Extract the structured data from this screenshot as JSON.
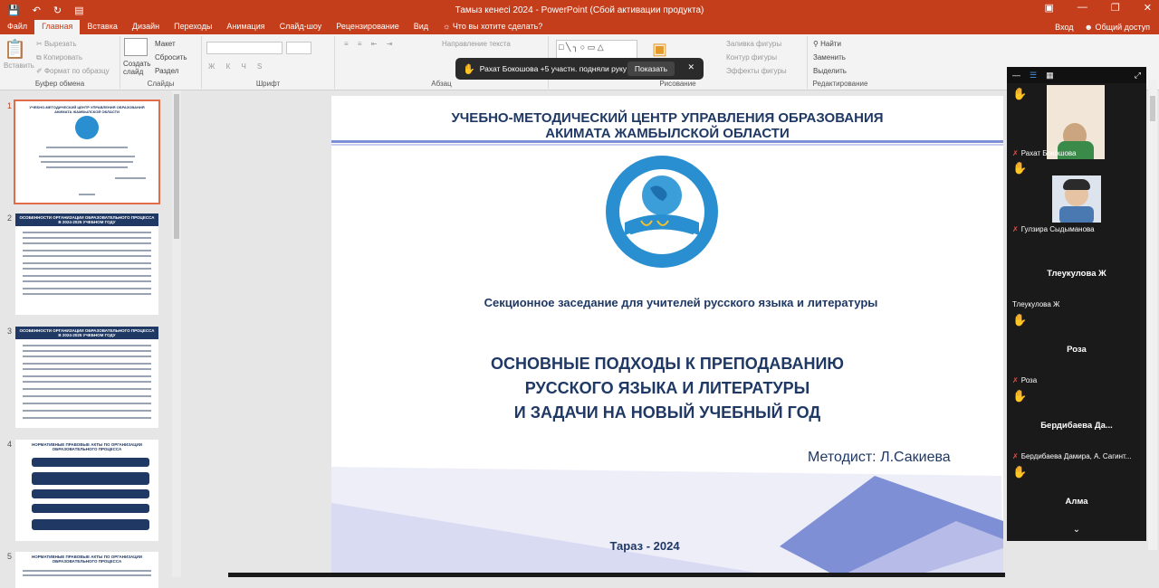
{
  "window": {
    "title": "Тамыз кенесі 2024 - PowerPoint (Сбой активации продукта)",
    "quick_access": [
      "save-icon",
      "undo-icon",
      "redo-icon",
      "present-icon"
    ]
  },
  "tabs": [
    "Файл",
    "Главная",
    "Вставка",
    "Дизайн",
    "Переходы",
    "Анимация",
    "Слайд-шоу",
    "Рецензирование",
    "Вид"
  ],
  "active_tab": "Главная",
  "tell_me": "Что вы хотите сделать?",
  "account": {
    "signin": "Вход",
    "share": "Общий доступ"
  },
  "ribbon": {
    "clipboard": {
      "label": "Буфер обмена",
      "paste": "Вставить",
      "cut": "Вырезать",
      "copy": "Копировать",
      "format": "Формат по образцу"
    },
    "slides": {
      "label": "Слайды",
      "new": "Создать слайд",
      "layout": "Макет",
      "reset": "Сбросить",
      "section": "Раздел"
    },
    "font": {
      "label": "Шрифт"
    },
    "paragraph": {
      "label": "Абзац",
      "direction": "Направление текста"
    },
    "drawing": {
      "label": "Рисование",
      "fill": "Заливка фигуры",
      "outline": "Контур фигуры",
      "effects": "Эффекты фигуры"
    },
    "editing": {
      "label": "Редактирование",
      "find": "Найти",
      "replace": "Заменить",
      "select": "Выделить"
    }
  },
  "toast": {
    "text": "Рахат Бокошова +5 участн. подняли руку",
    "button": "Показать"
  },
  "thumbnails": [
    {
      "num": "1",
      "title": "УЧЕБНО-МЕТОДИЧЕСКИЙ ЦЕНТР УПРАВЛЕНИЯ ОБРАЗОВАНИЯ АКИМАТА ЖАМБЫЛСКОЙ ОБЛАСТИ",
      "selected": true
    },
    {
      "num": "2",
      "title": "ОСОБЕННОСТИ ОРГАНИЗАЦИИ ОБРАЗОВАТЕЛЬНОГО ПРОЦЕССА В 2024-2025 УЧЕБНОМ ГОДУ",
      "selected": false
    },
    {
      "num": "3",
      "title": "ОСОБЕННОСТИ ОРГАНИЗАЦИИ ОБРАЗОВАТЕЛЬНОГО ПРОЦЕССА В 2024-2025 УЧЕБНОМ ГОДУ",
      "selected": false
    },
    {
      "num": "4",
      "title": "НОРМАТИВНЫЕ ПРАВОВЫЕ АКТЫ ПО ОРГАНИЗАЦИИ ОБРАЗОВАТЕЛЬНОГО ПРОЦЕССА",
      "selected": false
    },
    {
      "num": "5",
      "title": "НОРМАТИВНЫЕ ПРАВОВЫЕ АКТЫ ПО ОРГАНИЗАЦИИ ОБРАЗОВАТЕЛЬНОГО ПРОЦЕССА",
      "selected": false
    }
  ],
  "slide": {
    "header_line1": "УЧЕБНО-МЕТОДИЧЕСКИЙ ЦЕНТР УПРАВЛЕНИЯ ОБРАЗОВАНИЯ",
    "header_line2": "АКИМАТА ЖАМБЫЛСКОЙ ОБЛАСТИ",
    "subtitle": "Секционное заседание для учителей русского языка и литературы",
    "title_line1": "ОСНОВНЫЕ ПОДХОДЫ К ПРЕПОДАВАНИЮ",
    "title_line2": "РУССКОГО ЯЗЫКА И ЛИТЕРАТУРЫ",
    "title_line3": "И ЗАДАЧИ НА НОВЫЙ УЧЕБНЫЙ ГОД",
    "author": "Методист: Л.Сакиева",
    "footer": "Тараз - 2024",
    "colors": {
      "navy": "#1f3864",
      "accent": "#7f8fd6",
      "light": "#c9ccee"
    }
  },
  "gallery": {
    "participants": [
      {
        "name": "Рахат Бокошова",
        "hand": true,
        "video": true
      },
      {
        "name": "Гулзира Сыдыманова",
        "hand": true,
        "video": true
      },
      {
        "name": "Тлеукулова Ж",
        "label": "Тлеукулова Ж",
        "hand": true,
        "video": false
      },
      {
        "name": "Роза",
        "label": "Роза",
        "hand": true,
        "video": false
      },
      {
        "name": "Бердибаева Дамира,  А. Сагинт...",
        "label": "Бердибаева  Да...",
        "hand": true,
        "video": false
      },
      {
        "name": "Алма",
        "label": "Алма",
        "hand": false,
        "video": false
      }
    ]
  }
}
